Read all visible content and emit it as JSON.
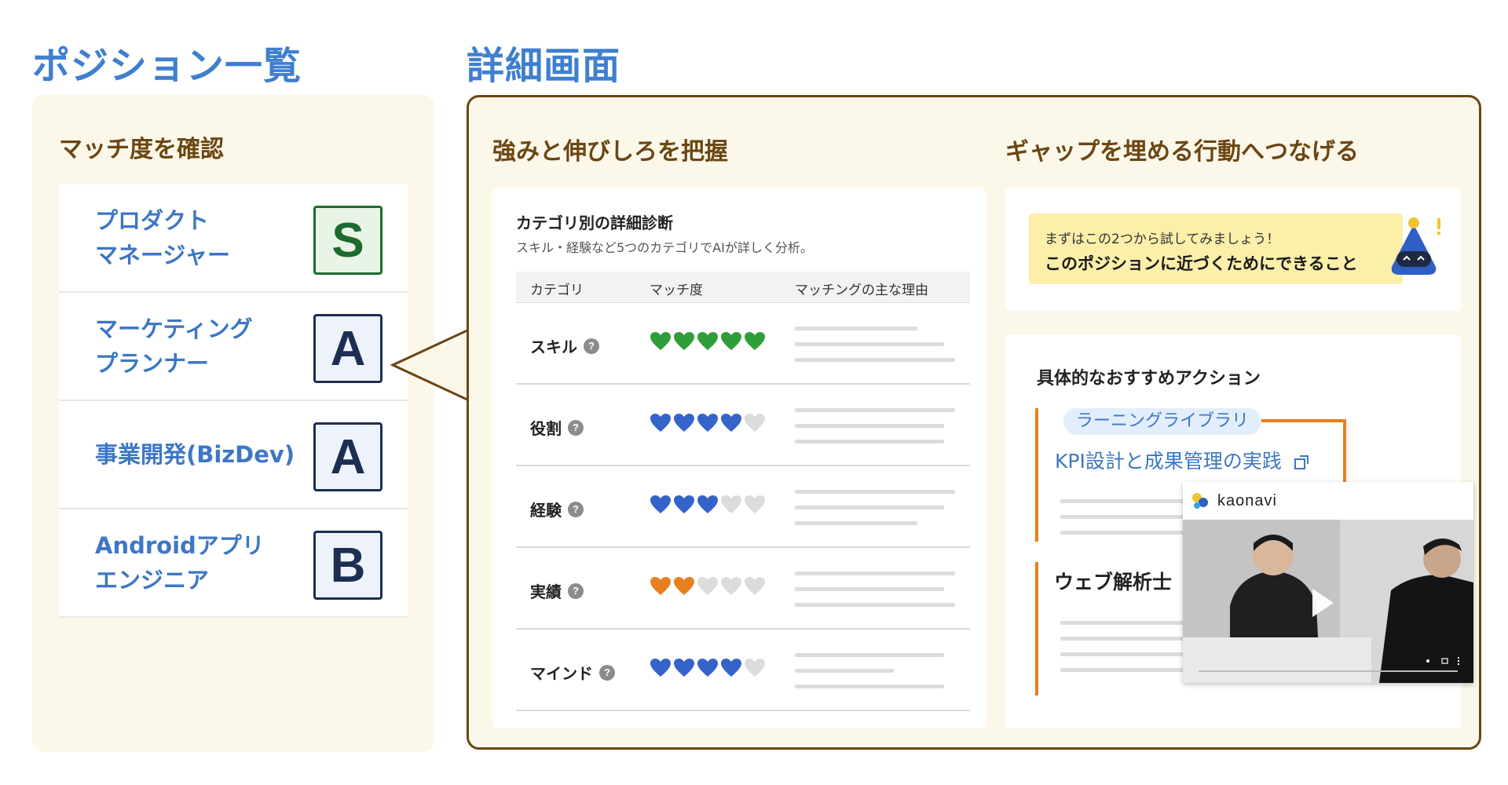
{
  "headings": {
    "list": "ポジション一覧",
    "detail": "詳細画面"
  },
  "left_panel": {
    "title": "マッチ度を確認",
    "positions": [
      {
        "name_line1": "プロダクト",
        "name_line2": "マネージャー",
        "rank": "S"
      },
      {
        "name_line1": "マーケティング",
        "name_line2": "プランナー",
        "rank": "A"
      },
      {
        "name_line1": "事業開発(BizDev)",
        "name_line2": "",
        "rank": "A"
      },
      {
        "name_line1": "Androidアプリ",
        "name_line2": "エンジニア",
        "rank": "B"
      }
    ]
  },
  "detail": {
    "strengths_title": "強みと伸びしろを把握",
    "gap_title": "ギャップを埋める行動へつなげる",
    "diagnosis": {
      "title": "カテゴリ別の詳細診断",
      "subtitle": "スキル・経験など5つのカテゴリでAIが詳しく分析。",
      "columns": [
        "カテゴリ",
        "マッチ度",
        "マッチングの主な理由"
      ],
      "help_glyph": "?",
      "rows": [
        {
          "category": "スキル",
          "score": 5,
          "color": "#2e9e3a"
        },
        {
          "category": "役割",
          "score": 4,
          "color": "#3563c9"
        },
        {
          "category": "経験",
          "score": 3,
          "color": "#3563c9"
        },
        {
          "category": "実績",
          "score": 2,
          "color": "#e8801f"
        },
        {
          "category": "マインド",
          "score": 4,
          "color": "#3563c9"
        }
      ],
      "max_score": 5
    },
    "tip": {
      "line1": "まずはこの2つから試してみましょう！",
      "line2": "このポジションに近づくためにできること"
    },
    "actions": {
      "title": "具体的なおすすめアクション",
      "library_tag": "ラーニングライブラリ",
      "library_link": "KPI設計と成果管理の実践",
      "certificate": "ウェブ解析士",
      "video_brand": "kaonavi"
    }
  },
  "colors": {
    "accent_blue": "#3f7fcf",
    "brown": "#6b4613",
    "orange": "#e8801f",
    "green": "#2e9e3a"
  }
}
